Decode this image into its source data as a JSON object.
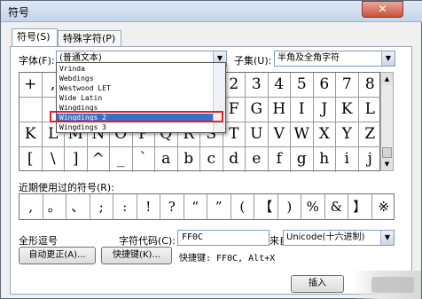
{
  "window": {
    "title": "符号",
    "close_glyph": "✕"
  },
  "tabs": [
    {
      "label": "符号(S)"
    },
    {
      "label": "特殊字符(P)"
    }
  ],
  "font": {
    "label": "字体(F):",
    "value": "(普通文本)"
  },
  "subset": {
    "label": "子集(U):",
    "value": "半角及全角字符"
  },
  "font_dropdown": {
    "items": [
      "Vrinda",
      "Webdings",
      "Westwood LET",
      "Wide Latin",
      "Wingdings",
      "Wingdings 2",
      "Wingdings 3"
    ],
    "selected_index": 5
  },
  "symbol_grid": {
    "rows": [
      [
        "+",
        ",",
        "",
        "",
        "",
        "",
        "",
        "",
        "",
        "2",
        "3",
        "4",
        "5",
        "6",
        "7",
        "8"
      ],
      [
        "",
        "",
        "",
        "",
        "",
        "",
        "",
        "",
        "",
        "F",
        "G",
        "H",
        "I",
        "J",
        "K",
        "L"
      ],
      [
        "K",
        "L",
        "M",
        "N",
        "O",
        "P",
        "Q",
        "R",
        "S",
        "T",
        "U",
        "V",
        "W",
        "X",
        "Y",
        "Z"
      ],
      [
        "[",
        "\\",
        "]",
        "^",
        "_",
        "`",
        "a",
        "b",
        "c",
        "d",
        "e",
        "f",
        "g",
        "h",
        "i",
        "j"
      ]
    ]
  },
  "recent": {
    "label": "近期使用过的符号(R):",
    "symbols": [
      ",",
      "。",
      "、",
      ";",
      ":",
      "!",
      "?",
      "“",
      "”",
      "(",
      "【",
      ")",
      "%",
      "&",
      "】",
      "※"
    ]
  },
  "char_info": {
    "name": "全形逗号",
    "code_label": "字符代码(C):",
    "code_value": "FF0C",
    "from_label": "来自(M):",
    "from_value": "Unicode(十六进制)"
  },
  "buttons": {
    "autocorrect": "自动更正(A)...",
    "shortcut_key": "快捷键(K)...",
    "shortcut_text": "快捷键: FF0C, Alt+X",
    "insert": "插入"
  }
}
